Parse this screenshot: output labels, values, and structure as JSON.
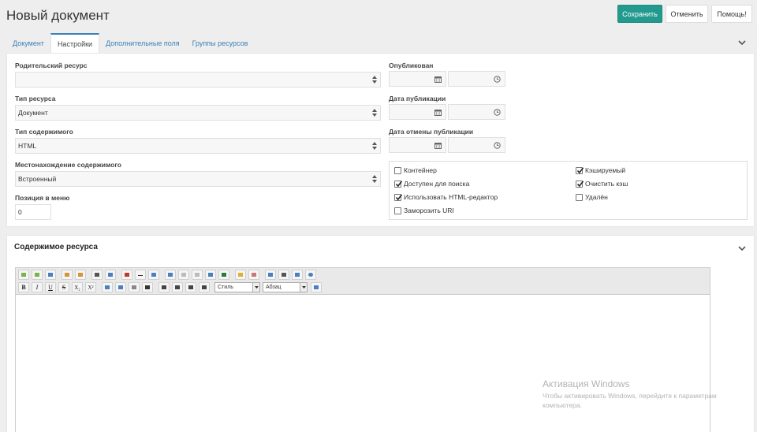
{
  "title": "Новый документ",
  "actions": {
    "save": "Сохранить",
    "cancel": "Отменить",
    "help": "Помощь!"
  },
  "tabs": [
    {
      "label": "Документ",
      "active": false
    },
    {
      "label": "Настройки",
      "active": true
    },
    {
      "label": "Дополнительные поля",
      "active": false
    },
    {
      "label": "Группы ресурсов",
      "active": false
    }
  ],
  "settings": {
    "parent": {
      "label": "Родительский ресурс",
      "value": ""
    },
    "resource_type": {
      "label": "Тип ресурса",
      "value": "Документ"
    },
    "content_type": {
      "label": "Тип содержимого",
      "value": "HTML"
    },
    "content_location": {
      "label": "Местонахождение содержимого",
      "value": "Встроенный"
    },
    "menu_position": {
      "label": "Позиция в меню",
      "value": "0"
    },
    "published": {
      "label": "Опубликован"
    },
    "publish_date": {
      "label": "Дата публикации"
    },
    "unpublish_date": {
      "label": "Дата отмены публикации"
    },
    "checkboxes": [
      {
        "label": "Контейнер",
        "checked": false
      },
      {
        "label": "Доступен для поиска",
        "checked": true
      },
      {
        "label": "Использовать HTML-редактор",
        "checked": true
      },
      {
        "label": "Заморозить URI",
        "checked": false
      },
      {
        "label": "Кэшируемый",
        "checked": true
      },
      {
        "label": "Очистить кэш",
        "checked": true
      },
      {
        "label": "Удалён",
        "checked": false
      }
    ]
  },
  "content": {
    "title": "Содержимое ресурса",
    "toolbar": {
      "bold": "B",
      "italic": "I",
      "underline": "U",
      "strike": "S",
      "sub": "X₂",
      "sup": "X²",
      "style_select": "Стиль",
      "format_select": "Абзац"
    }
  },
  "watermark": {
    "title": "Активация Windows",
    "text": "Чтобы активировать Windows, перейдите к параметрам компьютера."
  },
  "colors": {
    "accent": "#239a8e",
    "link": "#3a7fb8"
  }
}
